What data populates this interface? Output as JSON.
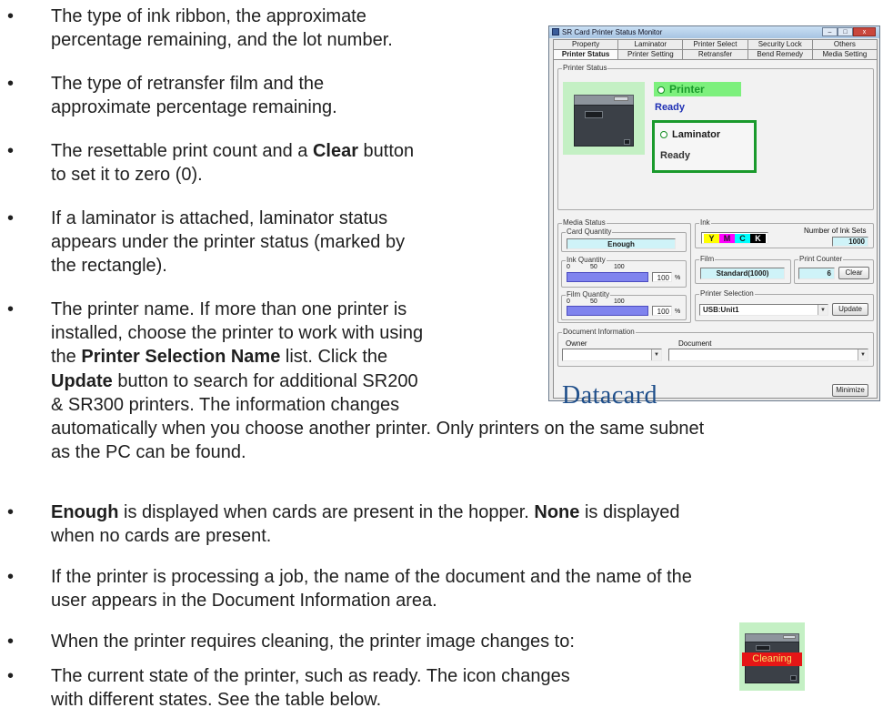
{
  "bullet_glyph": "•",
  "bullets": [
    {
      "lines": [
        [
          {
            "t": "The type of ink ribbon, the approximate"
          }
        ],
        [
          {
            "t": "percentage remaining, and the lot number."
          }
        ]
      ]
    },
    {
      "lines": [
        [
          {
            "t": "The type of retransfer film and the"
          }
        ],
        [
          {
            "t": "approximate percentage remaining."
          }
        ]
      ]
    },
    {
      "lines": [
        [
          {
            "t": "The resettable print count and a "
          },
          {
            "t": "Clear",
            "b": true
          },
          {
            "t": " button"
          }
        ],
        [
          {
            "t": "to set it to zero (0)."
          }
        ]
      ]
    },
    {
      "lines": [
        [
          {
            "t": "If a laminator is attached, laminator status"
          }
        ],
        [
          {
            "t": "appears under the printer status (marked by"
          }
        ],
        [
          {
            "t": "the rectangle)."
          }
        ]
      ]
    },
    {
      "lines": [
        [
          {
            "t": "The printer name. If more than one printer is"
          }
        ],
        [
          {
            "t": "installed, choose the printer to work with using"
          }
        ],
        [
          {
            "t": "the "
          },
          {
            "t": "Printer Selection Name",
            "b": true
          },
          {
            "t": " list. Click the"
          }
        ],
        [
          {
            "t": "Update",
            "b": true
          },
          {
            "t": " button to search for additional SR200"
          }
        ],
        [
          {
            "t": "& SR300 printers. The information changes"
          }
        ],
        [
          {
            "t": "automatically when you choose another printer. Only printers on the same subnet"
          }
        ],
        [
          {
            "t": "as the PC can be found."
          }
        ]
      ]
    },
    {
      "lines": [
        [
          {
            "t": "Enough",
            "b": true
          },
          {
            "t": " is displayed when cards are present in the hopper. "
          },
          {
            "t": "None",
            "b": true
          },
          {
            "t": " is displayed"
          }
        ],
        [
          {
            "t": "when no cards are present."
          }
        ]
      ]
    },
    {
      "lines": [
        [
          {
            "t": "If the printer is processing a job, the name of the document and the name of the"
          }
        ],
        [
          {
            "t": "user appears in the Document Information area."
          }
        ]
      ]
    },
    {
      "lines": [
        [
          {
            "t": "When the printer requires cleaning, the printer image changes to:"
          }
        ]
      ]
    },
    {
      "lines": [
        [
          {
            "t": "The current state of the printer, such as ready. The icon changes"
          }
        ],
        [
          {
            "t": "with different states. See the table below."
          }
        ]
      ]
    }
  ],
  "window": {
    "title": "SR Card Printer Status Monitor",
    "controls": [
      "–",
      "□",
      "x"
    ],
    "tabs_row1": [
      "Property",
      "Laminator",
      "Printer Select",
      "Security Lock",
      "Others"
    ],
    "tabs_row2": [
      "Printer Status",
      "Printer Setting",
      "Retransfer",
      "Bend Remedy",
      "Media Setting"
    ],
    "printer_status_label": "Printer Status",
    "printer_name": "Printer",
    "printer_state": "Ready",
    "laminator_name": "Laminator",
    "laminator_state": "Ready",
    "media_status_label": "Media Status",
    "card_quantity_label": "Card Quantity",
    "card_quantity_value": "Enough",
    "ink_quantity_label": "Ink Quantity",
    "film_quantity_label": "Film Quantity",
    "scale": [
      "0",
      "50",
      "100"
    ],
    "ink_percent": "100",
    "film_percent": "100",
    "percent_sign": "%",
    "ink_label": "Ink",
    "ink_colors": [
      "Y",
      "M",
      "C",
      "K"
    ],
    "number_of_ink_sets_label": "Number of Ink Sets",
    "number_of_ink_sets": "1000",
    "film_label": "Film",
    "film_value": "Standard(1000)",
    "print_counter_label": "Print Counter",
    "print_counter_value": "6",
    "clear_button": "Clear",
    "printer_selection_label": "Printer Selection",
    "printer_selection_value": "USB:Unit1",
    "update_button": "Update",
    "document_info_label": "Document Information",
    "owner_label": "Owner",
    "document_label": "Document",
    "brand": "Datacard",
    "minimize_button": "Minimize"
  },
  "cleaning_image_label": "Cleaning",
  "colors": {
    "ready_blue": "#1e2fb4",
    "status_green": "#1a9a2c",
    "brand_blue": "#1e4e8a",
    "cleaning_red": "#e61616"
  }
}
